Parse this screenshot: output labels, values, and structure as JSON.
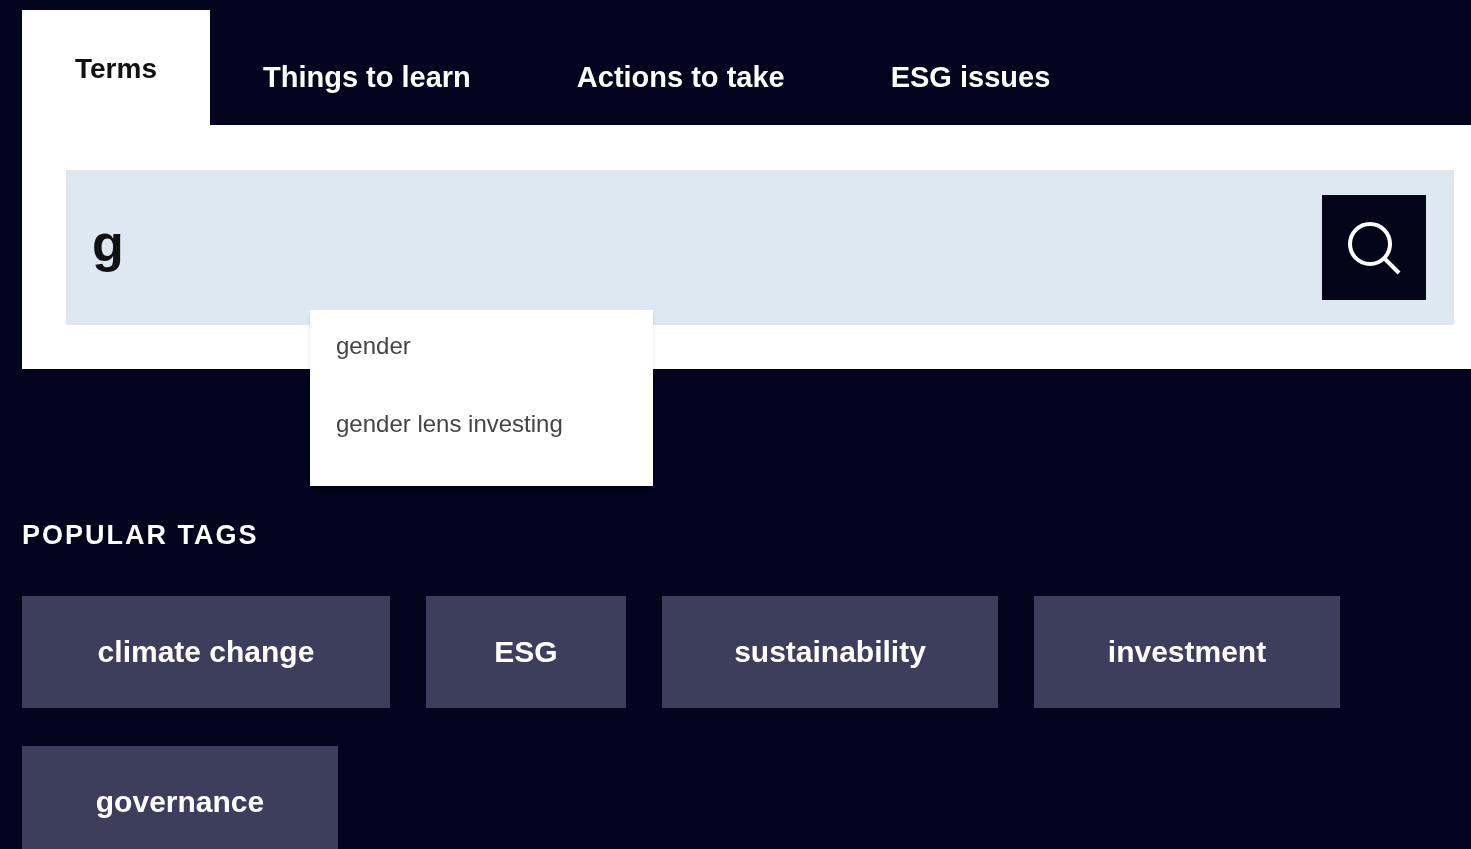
{
  "tabs": [
    {
      "label": "Terms",
      "selected": true
    },
    {
      "label": "Things to learn",
      "selected": false
    },
    {
      "label": "Actions to take",
      "selected": false
    },
    {
      "label": "ESG issues",
      "selected": false
    }
  ],
  "search": {
    "value": "g"
  },
  "suggestions": [
    "gender",
    "gender lens investing"
  ],
  "popular_tags": {
    "heading": "POPULAR TAGS",
    "tags": [
      "climate change",
      "ESG",
      "sustainability",
      "investment",
      "governance"
    ]
  }
}
